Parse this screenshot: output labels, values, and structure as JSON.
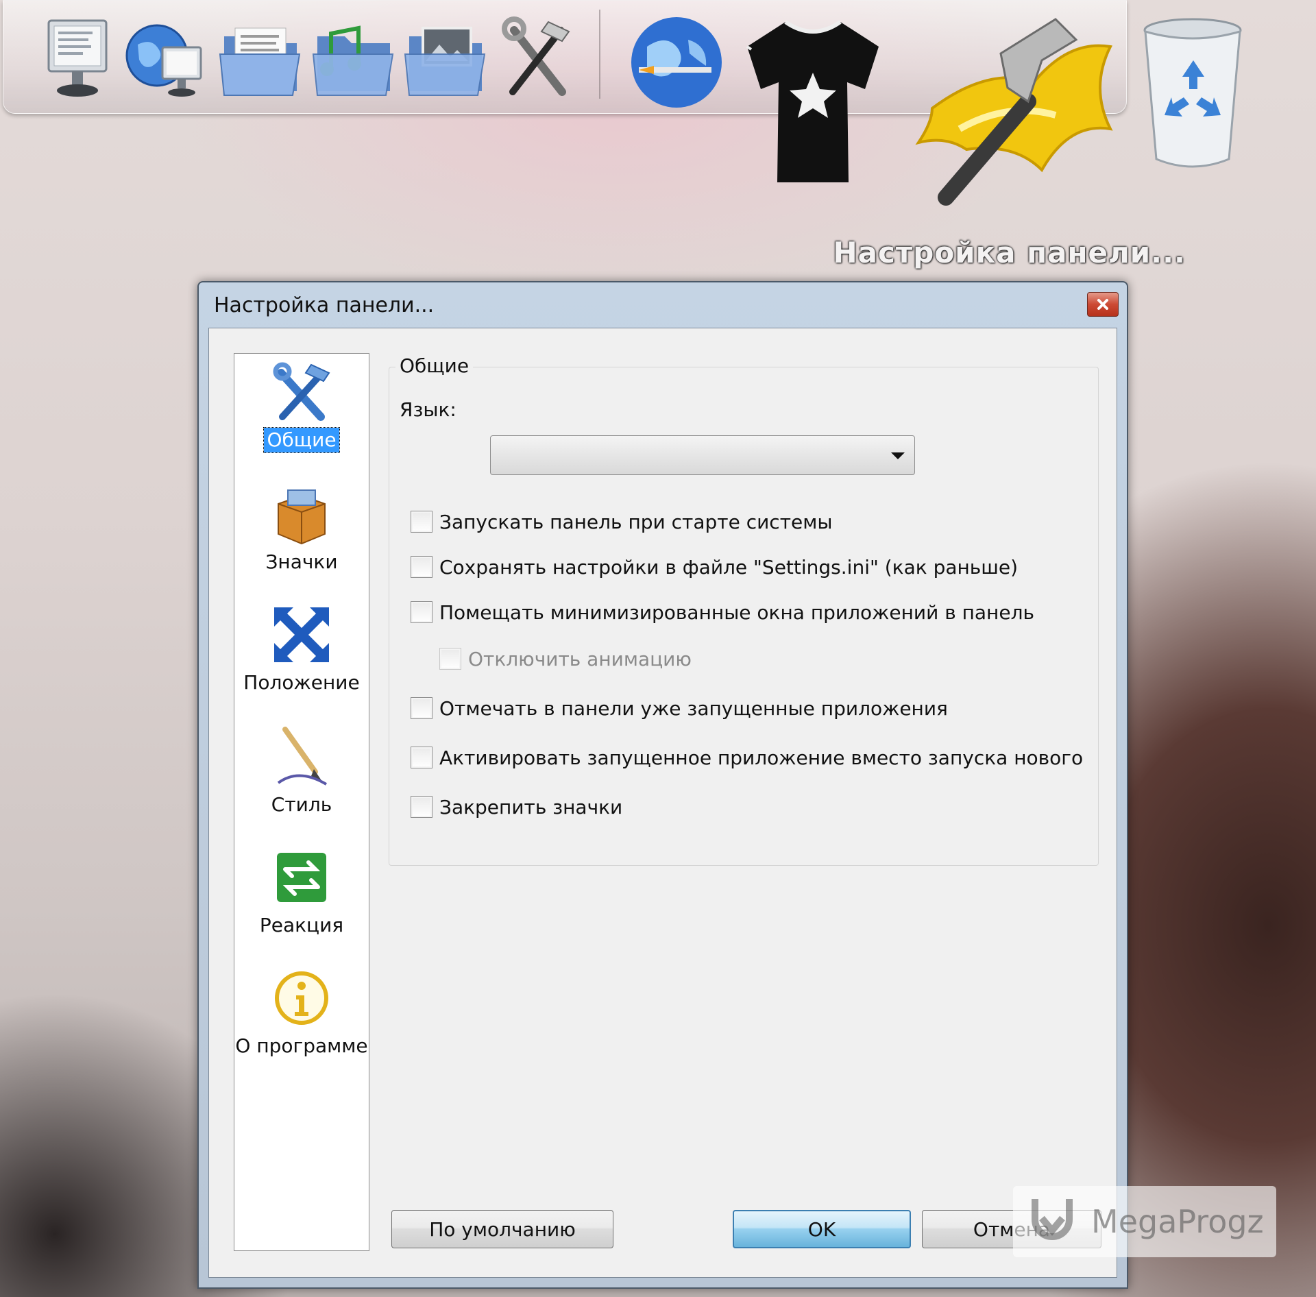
{
  "dock": {
    "caption": "Настройка панели...",
    "icons": [
      "computer-icon",
      "network-computer-icon",
      "documents-folder-icon",
      "music-folder-icon",
      "pictures-folder-icon",
      "tools-icon",
      "internet-globe-icon",
      "tshirt-icon",
      "settings-hammer-icon",
      "recycle-bin-icon"
    ]
  },
  "window": {
    "title": "Настройка панели...",
    "close_label": "×"
  },
  "sidebar": {
    "items": [
      {
        "label": "Общие",
        "icon": "tools-icon",
        "selected": true
      },
      {
        "label": "Значки",
        "icon": "box-icon",
        "selected": false
      },
      {
        "label": "Положение",
        "icon": "arrows-icon",
        "selected": false
      },
      {
        "label": "Стиль",
        "icon": "brush-icon",
        "selected": false
      },
      {
        "label": "Реакция",
        "icon": "exchange-icon",
        "selected": false
      },
      {
        "label": "О программе",
        "icon": "info-icon",
        "selected": false
      }
    ]
  },
  "general": {
    "group_title": "Общие",
    "language_label": "Язык:",
    "language_value": "",
    "options": [
      {
        "label": "Запускать панель при старте системы",
        "checked": false,
        "enabled": true
      },
      {
        "label": "Сохранять настройки в файле \"Settings.ini\" (как раньше)",
        "checked": false,
        "enabled": true
      },
      {
        "label": "Помещать минимизированные окна приложений в панель",
        "checked": false,
        "enabled": true
      },
      {
        "label": "Отключить анимацию",
        "checked": false,
        "enabled": false
      },
      {
        "label": "Отмечать в панели уже запущенные приложения",
        "checked": false,
        "enabled": true
      },
      {
        "label": "Активировать запущенное приложение вместо запуска нового",
        "checked": false,
        "enabled": true
      },
      {
        "label": "Закрепить значки",
        "checked": false,
        "enabled": true
      }
    ]
  },
  "buttons": {
    "defaults": "По умолчанию",
    "ok": "OK",
    "cancel": "Отмена"
  },
  "watermark": {
    "text": "MegaProgz"
  }
}
